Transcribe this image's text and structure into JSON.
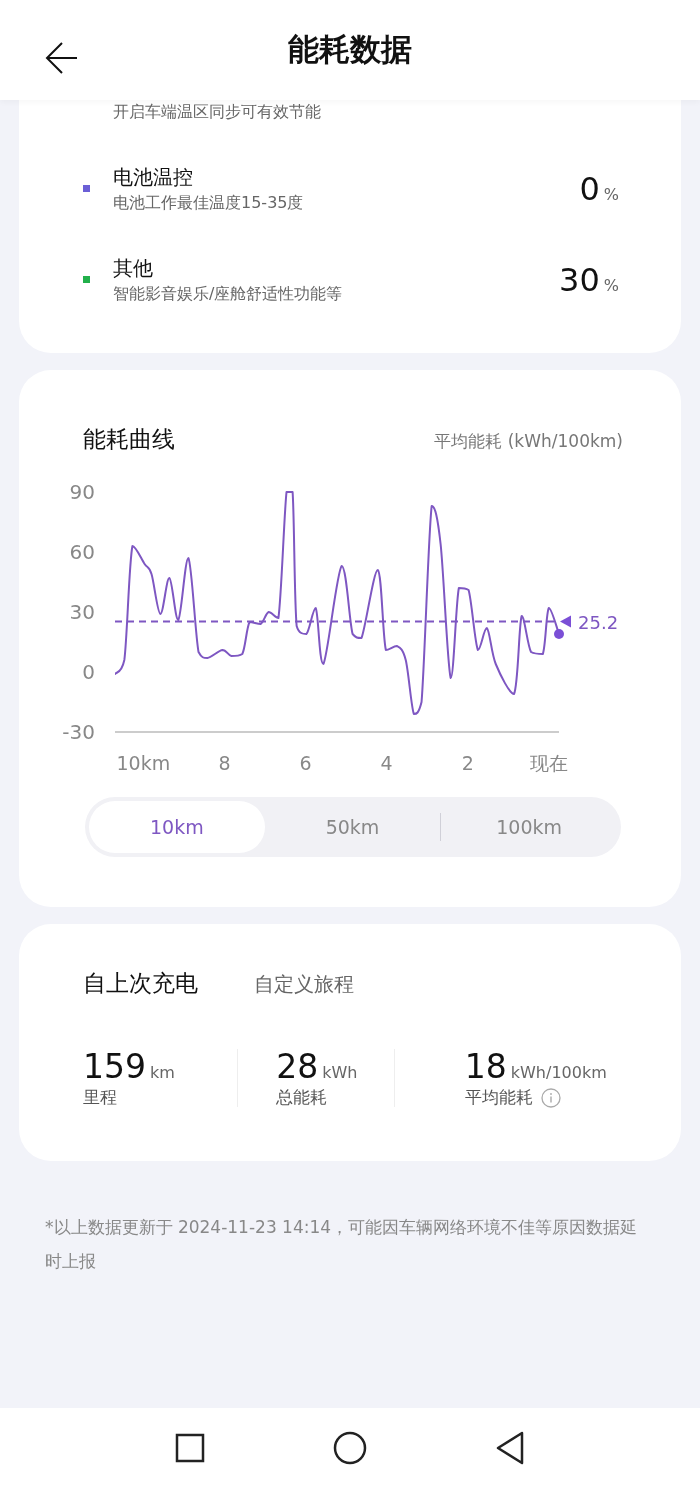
{
  "header": {
    "title": "能耗数据"
  },
  "breakdown": [
    {
      "subtitle": "开启车端温区同步可有效节能"
    },
    {
      "title": "电池温控",
      "subtitle": "电池工作最佳温度15-35度",
      "value": "0",
      "unit": "%",
      "color": "#6b5fd6"
    },
    {
      "title": "其他",
      "subtitle": "智能影音娱乐/座舱舒适性功能等",
      "value": "30",
      "unit": "%",
      "color": "#22b04b"
    }
  ],
  "curve": {
    "title": "能耗曲线",
    "chart_data": {
      "type": "line",
      "ylabel": "平均能耗 (kWh/100km)",
      "ylim": [
        -30,
        90
      ],
      "yticks": [
        -30,
        0,
        30,
        60,
        90
      ],
      "xlim": [
        10.7,
        -0.25
      ],
      "xticks": [
        {
          "value": 10,
          "label": "10km"
        },
        8,
        6,
        4,
        2,
        {
          "value": 0,
          "label": "现在"
        }
      ],
      "x": [
        10.7,
        10.47,
        10.27,
        9.97,
        9.8,
        9.58,
        9.36,
        9.14,
        8.89,
        8.64,
        8.42,
        8.05,
        7.83,
        7.56,
        7.38,
        7.11,
        6.91,
        6.67,
        6.47,
        6.32,
        6.22,
        5.98,
        5.75,
        5.56,
        5.11,
        4.84,
        4.62,
        4.22,
        4.02,
        3.75,
        3.53,
        3.33,
        3.14,
        2.89,
        2.67,
        2.42,
        2.22,
        1.98,
        1.75,
        1.53,
        1.31,
        0.86,
        0.67,
        0.44,
        0.15,
        0,
        -0.25
      ],
      "series": [
        {
          "color": "#7e57c2",
          "values": [
            -1,
            6,
            63,
            54,
            49,
            29,
            47,
            26,
            57,
            10,
            7,
            11,
            8,
            9,
            25,
            24,
            30,
            27,
            90,
            90,
            23,
            19,
            32,
            4,
            53,
            19,
            17,
            51,
            11,
            13,
            6,
            -21,
            -15,
            83,
            64,
            -3,
            42,
            41,
            11,
            22,
            4,
            -11,
            28,
            10,
            9,
            32,
            19
          ]
        },
        {
          "color": "#7e57c2",
          "line_style": "dashed",
          "values": [
            25.2,
            25.2,
            25.2,
            25.2,
            25.2,
            25.2,
            25.2,
            25.2,
            25.2,
            25.2,
            25.2,
            25.2,
            25.2,
            25.2,
            25.2,
            25.2,
            25.2,
            25.2,
            25.2,
            25.2,
            25.2,
            25.2,
            25.2,
            25.2,
            25.2,
            25.2,
            25.2,
            25.2,
            25.2,
            25.2,
            25.2,
            25.2,
            25.2,
            25.2,
            25.2,
            25.2,
            25.2,
            25.2,
            25.2,
            25.2,
            25.2,
            25.2,
            25.2,
            25.2,
            25.2,
            25.2,
            25.2
          ]
        }
      ]
    },
    "average_label": "25.2",
    "ranges": [
      {
        "label": "10km",
        "selected": true
      },
      {
        "label": "50km",
        "selected": false
      },
      {
        "label": "100km",
        "selected": false
      }
    ]
  },
  "trip": {
    "tabs": [
      {
        "label": "自上次充电",
        "selected": true
      },
      {
        "label": "自定义旅程",
        "selected": false
      }
    ],
    "stats": [
      {
        "value": "159",
        "unit": "km",
        "label": "里程",
        "info": false
      },
      {
        "value": "28",
        "unit": "kWh",
        "label": "总能耗",
        "info": false
      },
      {
        "value": "18",
        "unit": "kWh/100km",
        "label": "平均能耗",
        "info": true
      }
    ]
  },
  "footnote": "*以上数据更新于 2024-11-23 14:14，可能因车辆网络环境不佳等原因数据延时上报"
}
